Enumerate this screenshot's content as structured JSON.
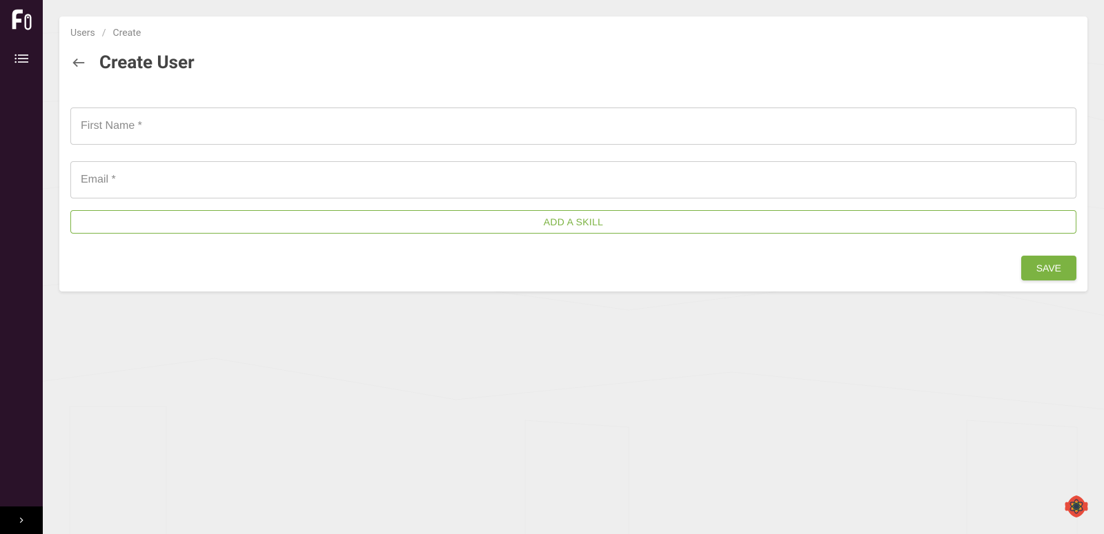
{
  "breadcrumb": {
    "root": "Users",
    "separator": "/",
    "current": "Create"
  },
  "page": {
    "title": "Create User"
  },
  "form": {
    "first_name": {
      "placeholder": "First Name *",
      "value": ""
    },
    "email": {
      "placeholder": "Email *",
      "value": ""
    },
    "add_skill_label": "ADD A SKILL",
    "save_label": "SAVE"
  },
  "colors": {
    "sidebar_bg": "#2a1229",
    "accent_green": "#7cb342",
    "page_bg": "#eeeeee"
  }
}
